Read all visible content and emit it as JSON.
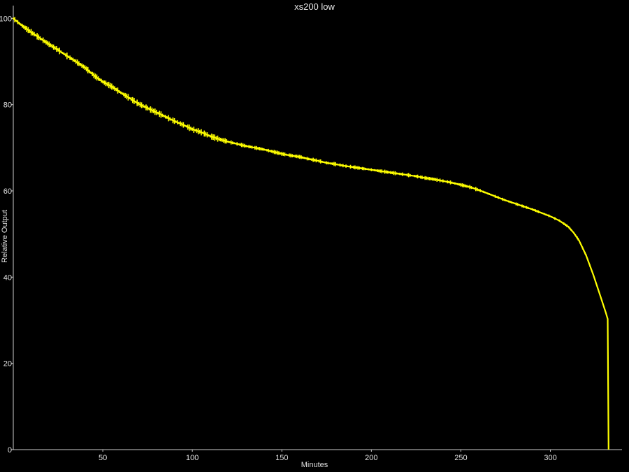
{
  "chart_data": {
    "type": "line",
    "title": "xs200 low",
    "xlabel": "Minutes",
    "ylabel": "Relative Output",
    "xlim": [
      0,
      340
    ],
    "ylim": [
      0,
      102
    ],
    "x_ticks": [
      50,
      100,
      150,
      200,
      250,
      300
    ],
    "y_ticks": [
      0,
      20,
      40,
      60,
      80,
      100
    ],
    "grid": false,
    "colors": {
      "background": "#000000",
      "line": "#ffff00",
      "axis": "#cccccc",
      "text": "#e0e0e0"
    },
    "series": [
      {
        "points": [
          [
            0,
            100
          ],
          [
            5,
            98.3
          ],
          [
            10,
            96.8
          ],
          [
            15,
            95.4
          ],
          [
            20,
            94.0
          ],
          [
            25,
            92.7
          ],
          [
            30,
            91.3
          ],
          [
            35,
            90.0
          ],
          [
            40,
            88.6
          ],
          [
            45,
            86.8
          ],
          [
            50,
            85.3
          ],
          [
            55,
            84.2
          ],
          [
            60,
            82.8
          ],
          [
            65,
            81.5
          ],
          [
            70,
            80.2
          ],
          [
            75,
            79.2
          ],
          [
            80,
            78.2
          ],
          [
            85,
            77.2
          ],
          [
            90,
            76.2
          ],
          [
            95,
            75.3
          ],
          [
            100,
            74.3
          ],
          [
            105,
            73.6
          ],
          [
            110,
            72.7
          ],
          [
            115,
            72.0
          ],
          [
            120,
            71.4
          ],
          [
            125,
            70.9
          ],
          [
            130,
            70.4
          ],
          [
            135,
            70.0
          ],
          [
            140,
            69.6
          ],
          [
            145,
            69.1
          ],
          [
            150,
            68.6
          ],
          [
            155,
            68.2
          ],
          [
            160,
            67.9
          ],
          [
            165,
            67.4
          ],
          [
            170,
            67.0
          ],
          [
            175,
            66.5
          ],
          [
            180,
            66.2
          ],
          [
            185,
            65.8
          ],
          [
            190,
            65.5
          ],
          [
            195,
            65.2
          ],
          [
            200,
            64.9
          ],
          [
            205,
            64.6
          ],
          [
            210,
            64.3
          ],
          [
            215,
            64.0
          ],
          [
            220,
            63.7
          ],
          [
            225,
            63.4
          ],
          [
            230,
            63.0
          ],
          [
            235,
            62.7
          ],
          [
            240,
            62.3
          ],
          [
            245,
            61.9
          ],
          [
            250,
            61.4
          ],
          [
            255,
            60.9
          ],
          [
            260,
            60.2
          ],
          [
            265,
            59.4
          ],
          [
            270,
            58.6
          ],
          [
            275,
            57.8
          ],
          [
            280,
            57.1
          ],
          [
            285,
            56.4
          ],
          [
            290,
            55.7
          ],
          [
            295,
            54.9
          ],
          [
            300,
            54.1
          ],
          [
            305,
            53.1
          ],
          [
            310,
            51.7
          ],
          [
            313,
            50.3
          ],
          [
            316,
            48.5
          ],
          [
            320,
            45.0
          ],
          [
            324,
            40.5
          ],
          [
            328,
            35.5
          ],
          [
            331,
            31.7
          ],
          [
            332,
            30.3
          ],
          [
            332.5,
            0
          ]
        ]
      }
    ]
  }
}
